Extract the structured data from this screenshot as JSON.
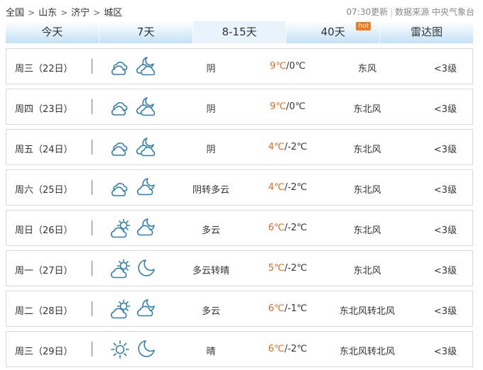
{
  "breadcrumb": {
    "items": [
      "全国",
      "山东",
      "济宁",
      "城区"
    ],
    "separator": ">"
  },
  "update": {
    "time_text": "07:30更新",
    "source_text": "数据来源 中央气象台"
  },
  "tabs": [
    {
      "label": "今天",
      "active": false
    },
    {
      "label": "7天",
      "active": false
    },
    {
      "label": "8-15天",
      "active": true
    },
    {
      "label": "40天",
      "active": false,
      "badge": "hot"
    },
    {
      "label": "雷达图",
      "active": false
    }
  ],
  "colors": {
    "accent": "#2f7fb3",
    "high_temp": "#e8691d",
    "hot_badge": "#f27a1a"
  },
  "forecast": [
    {
      "day": "周三（22日）",
      "icon_day": "cloudy-icon",
      "icon_night": "cloudy-moon-icon",
      "weather": "阴",
      "high": "9℃",
      "low": "/0℃",
      "wind": "东风",
      "level": "<3级"
    },
    {
      "day": "周四（23日）",
      "icon_day": "cloudy-icon",
      "icon_night": "cloudy-moon-icon",
      "weather": "阴",
      "high": "9℃",
      "low": "/0℃",
      "wind": "东北风",
      "level": "<3级"
    },
    {
      "day": "周五（24日）",
      "icon_day": "cloudy-icon",
      "icon_night": "cloudy-moon-icon",
      "weather": "阴",
      "high": "4℃",
      "low": "/-2℃",
      "wind": "东北风",
      "level": "<3级"
    },
    {
      "day": "周六（25日）",
      "icon_day": "cloudy-icon",
      "icon_night": "moon-cloud-icon",
      "weather": "阴转多云",
      "high": "4℃",
      "low": "/-2℃",
      "wind": "东北风",
      "level": "<3级"
    },
    {
      "day": "周日（26日）",
      "icon_day": "sun-cloud-icon",
      "icon_night": "moon-cloud-icon",
      "weather": "多云",
      "high": "6℃",
      "low": "/-2℃",
      "wind": "东北风",
      "level": "<3级"
    },
    {
      "day": "周一（27日）",
      "icon_day": "sun-cloud-icon",
      "icon_night": "moon-icon",
      "weather": "多云转晴",
      "high": "5℃",
      "low": "/-2℃",
      "wind": "东北风",
      "level": "<3级"
    },
    {
      "day": "周二（28日）",
      "icon_day": "sun-cloud-icon",
      "icon_night": "moon-cloud-icon",
      "weather": "多云",
      "high": "6℃",
      "low": "/-1℃",
      "wind": "东北风转北风",
      "level": "<3级"
    },
    {
      "day": "周三（29日）",
      "icon_day": "sun-icon",
      "icon_night": "moon-icon",
      "weather": "晴",
      "high": "6℃",
      "low": "/-2℃",
      "wind": "东北风转北风",
      "level": "<3级"
    }
  ]
}
